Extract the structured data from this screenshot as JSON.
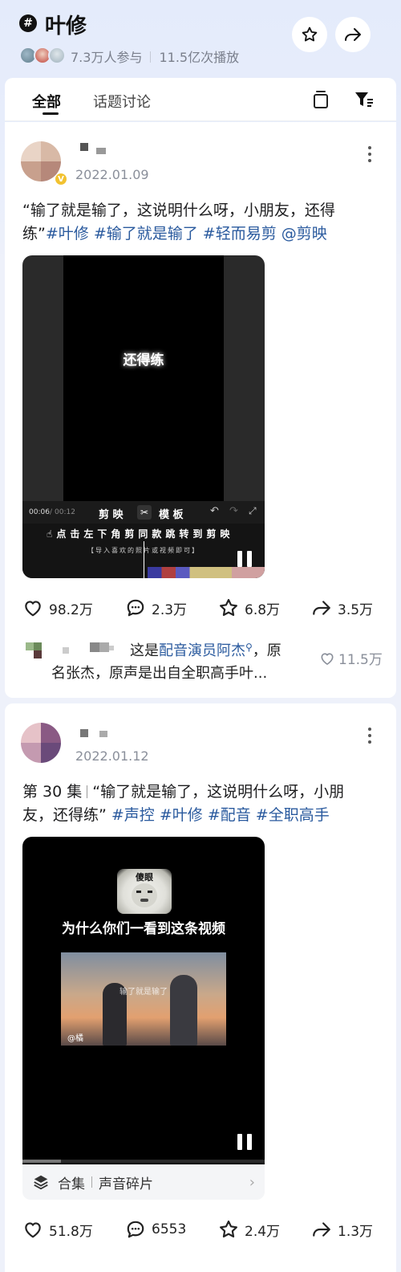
{
  "topic": {
    "badge": "#",
    "title": "叶修",
    "participants": "7.3万人参与",
    "plays": "11.5亿次播放"
  },
  "tabs": [
    {
      "label": "全部",
      "active": true
    },
    {
      "label": "话题讨论",
      "active": false
    }
  ],
  "posts": [
    {
      "date": "2022.01.09",
      "text_line1": "“输了就是输了，这说明什么呀，小朋友，还得",
      "text_line2_plain": "练”",
      "tags": [
        "#叶修",
        "#输了就是输了",
        "#轻而易剪",
        "@剪映"
      ],
      "video": {
        "overlay_text": "还得练",
        "time_current": "00:06",
        "time_total": "00:12",
        "brand": "剪 映",
        "brand2": "模 板",
        "hint": "点击左下角剪同款跳转到剪映",
        "hint_sub": "【导入喜欢的照片或视频即可】"
      },
      "stats": {
        "likes": "98.2万",
        "comments": "2.3万",
        "favorites": "6.8万",
        "shares": "3.5万"
      },
      "top_comment": {
        "prefix": "这是",
        "link": "配音演员阿杰",
        "line1_rest": "，原",
        "line2": "名张杰，原声是出自全职高手叶...",
        "likes": "11.5万"
      }
    },
    {
      "date": "2022.01.12",
      "episode": "第 30 集",
      "text_line1_rest": "“输了就是输了，这说明什么呀，小朋",
      "text_line2_plain": "友，还得练”",
      "tags": [
        "#声控",
        "#叶修",
        "#配音",
        "#全职高手"
      ],
      "video": {
        "meme_caption": "傻眼",
        "headline": "为什么你们一看到这条视频",
        "scene_text": "输了就是输了",
        "watermark": "@橘"
      },
      "collection": {
        "label": "合集",
        "name": "声音碎片"
      },
      "stats": {
        "likes": "51.8万",
        "comments": "6553",
        "favorites": "2.4万",
        "shares": "1.3万"
      }
    }
  ],
  "colors": {
    "tag": "#2a5a9e",
    "meta": "#7a7f8c",
    "background": "#eef1fa"
  }
}
